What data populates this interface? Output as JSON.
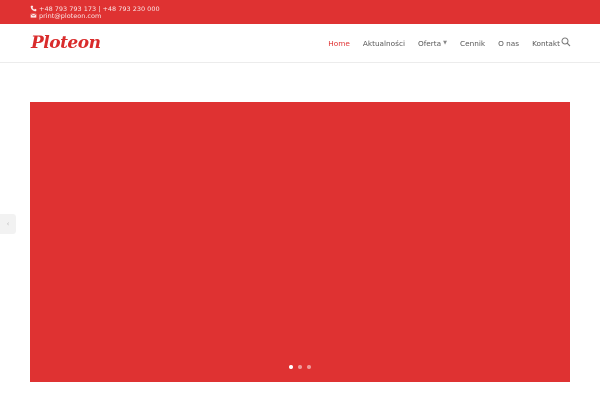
{
  "topbar": {
    "phone": "+48 793 793 173 | +48 793 230 000",
    "email": "print@ploteon.com",
    "phone_icon": "phone-icon",
    "email_icon": "envelope-icon",
    "background_color": "#df3232"
  },
  "header": {
    "logo_text": "Ploteon",
    "nav": [
      {
        "label": "Home",
        "active": true
      },
      {
        "label": "Aktualności",
        "active": false
      },
      {
        "label": "Oferta",
        "active": false,
        "has_dropdown": true
      },
      {
        "label": "Cennik",
        "active": false
      },
      {
        "label": "O nas",
        "active": false
      },
      {
        "label": "Kontakt",
        "active": false
      }
    ],
    "search_icon": "search-icon",
    "accent_color": "#df3232"
  },
  "slider": {
    "background_color": "#df3232",
    "dot_count": 3,
    "active_dot": 1
  }
}
